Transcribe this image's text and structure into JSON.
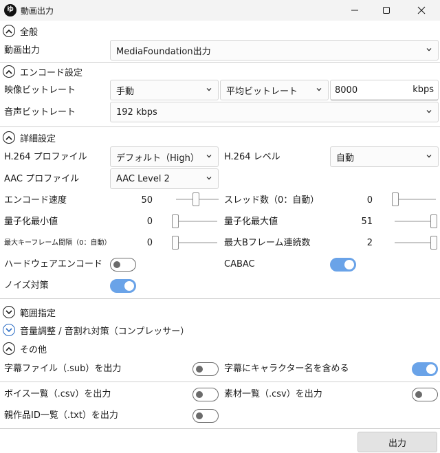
{
  "window": {
    "title": "動画出力",
    "app_icon": "ゆ"
  },
  "sections": {
    "general": "全般",
    "encode": "エンコード設定",
    "advanced": "詳細設定",
    "range": "範囲指定",
    "volume": "音量調整 / 音割れ対策（コンプレッサー）",
    "other": "その他"
  },
  "general": {
    "output_label": "動画出力",
    "output_value": "MediaFoundation出力"
  },
  "encode": {
    "video_bitrate_label": "映像ビットレート",
    "video_bitrate_mode": "手動",
    "video_bitrate_type": "平均ビットレート",
    "video_bitrate_value": "8000",
    "video_bitrate_unit": "kbps",
    "audio_bitrate_label": "音声ビットレート",
    "audio_bitrate_value": "192 kbps"
  },
  "advanced": {
    "h264_profile_label": "H.264 プロファイル",
    "h264_profile_value": "デフォルト（High）",
    "h264_level_label": "H.264 レベル",
    "h264_level_value": "自動",
    "aac_profile_label": "AAC プロファイル",
    "aac_profile_value": "AAC Level 2",
    "encode_speed_label": "エンコード速度",
    "encode_speed_value": "50",
    "thread_count_label": "スレッド数（0：自動）",
    "thread_count_value": "0",
    "qmin_label": "量子化最小値",
    "qmin_value": "0",
    "qmax_label": "量子化最大値",
    "qmax_value": "51",
    "keyframe_label": "最大キーフレーム間隔（0：自動）",
    "keyframe_value": "0",
    "bframes_label": "最大Bフレーム連続数",
    "bframes_value": "2",
    "hw_encode_label": "ハードウェアエンコード",
    "cabac_label": "CABAC",
    "noise_label": "ノイズ対策"
  },
  "other": {
    "subtitle_label": "字幕ファイル（.sub）を出力",
    "subtitle_char_label": "字幕にキャラクター名を含める",
    "voice_list_label": "ボイス一覧（.csv）を出力",
    "material_list_label": "素材一覧（.csv）を出力",
    "parent_list_label": "親作品ID一覧（.txt）を出力"
  },
  "footer": {
    "output_button": "出力"
  },
  "toggles": {
    "hw_encode": false,
    "cabac": true,
    "noise": true,
    "subtitle": false,
    "subtitle_char": true,
    "voice_list": false,
    "material_list": false,
    "parent_list": false
  },
  "colors": {
    "accent": "#6aa3e8",
    "titlebar": "#f3f3f3",
    "button": "#e3e3e3"
  }
}
